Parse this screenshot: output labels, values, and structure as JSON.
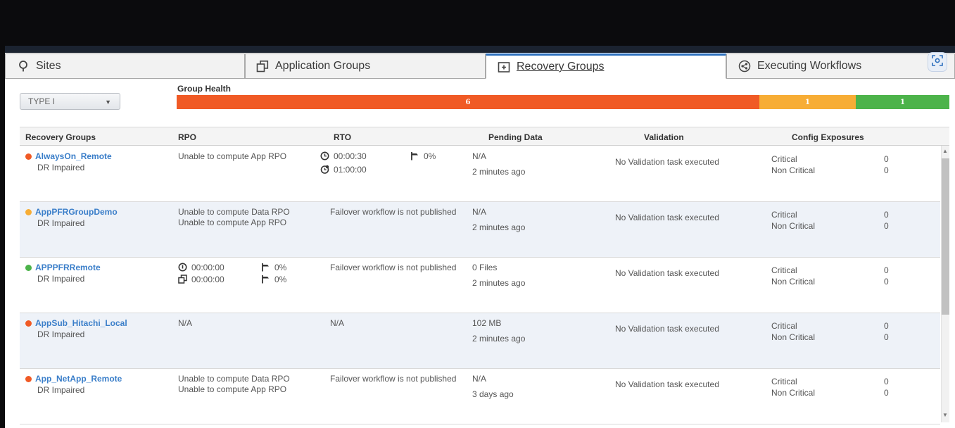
{
  "tabs": [
    {
      "label": "Sites",
      "icon": "location-pin-icon"
    },
    {
      "label": "Application Groups",
      "icon": "copy-icon"
    },
    {
      "label": "Recovery Groups",
      "icon": "plus-box-icon",
      "active": true
    },
    {
      "label": "Executing Workflows",
      "icon": "workflow-icon"
    }
  ],
  "filter": {
    "selected": "TYPE I"
  },
  "health": {
    "label": "Group Health",
    "segments": [
      {
        "value": "6",
        "color": "#f05a25"
      },
      {
        "value": "1",
        "color": "#f7ad35"
      },
      {
        "value": "1",
        "color": "#4cb34a"
      }
    ]
  },
  "columns": [
    "Recovery Groups",
    "RPO",
    "RTO",
    "Pending Data",
    "Validation",
    "Config Exposures"
  ],
  "rows": [
    {
      "name": "AlwaysOn_Remote",
      "status": "DR Impaired",
      "dot": "red",
      "rpo": [
        "Unable to compute App RPO"
      ],
      "rto_time1": "00:00:30",
      "rto_pct": "0%",
      "rto_time2": "01:00:00",
      "pending": "N/A",
      "pending_time": "2 minutes ago",
      "validation": "No Validation task executed",
      "crit_label": "Critical",
      "crit_val": "0",
      "noncrit_label": "Non Critical",
      "noncrit_val": "0"
    },
    {
      "name": "AppPFRGroupDemo",
      "status": "DR Impaired",
      "dot": "orange",
      "rpo": [
        "Unable to compute Data RPO",
        "Unable to compute App RPO"
      ],
      "rto": "Failover workflow is not published",
      "pending": "N/A",
      "pending_time": "2 minutes ago",
      "validation": "No Validation task executed",
      "crit_label": "Critical",
      "crit_val": "0",
      "noncrit_label": "Non Critical",
      "noncrit_val": "0"
    },
    {
      "name": "APPPFRRemote",
      "status": "DR Impaired",
      "dot": "green",
      "rpo_time1": "00:00:00",
      "rpo_pct1": "0%",
      "rpo_time2": "00:00:00",
      "rpo_pct2": "0%",
      "rto": "Failover workflow is not published",
      "pending": "0 Files",
      "pending_time": "2 minutes ago",
      "validation": "No Validation task executed",
      "crit_label": "Critical",
      "crit_val": "0",
      "noncrit_label": "Non Critical",
      "noncrit_val": "0"
    },
    {
      "name": "AppSub_Hitachi_Local",
      "status": "DR Impaired",
      "dot": "red",
      "rpo": [
        "N/A"
      ],
      "rto": "N/A",
      "pending": "102 MB",
      "pending_time": "2 minutes ago",
      "validation": "No Validation task executed",
      "crit_label": "Critical",
      "crit_val": "0",
      "noncrit_label": "Non Critical",
      "noncrit_val": "0"
    },
    {
      "name": "App_NetApp_Remote",
      "status": "DR Impaired",
      "dot": "red",
      "rpo": [
        "Unable to compute Data RPO",
        "Unable to compute App RPO"
      ],
      "rto": "Failover workflow is not published",
      "pending": "N/A",
      "pending_time": "3 days ago",
      "validation": "No Validation task executed",
      "crit_label": "Critical",
      "crit_val": "0",
      "noncrit_label": "Non Critical",
      "noncrit_val": "0"
    }
  ]
}
